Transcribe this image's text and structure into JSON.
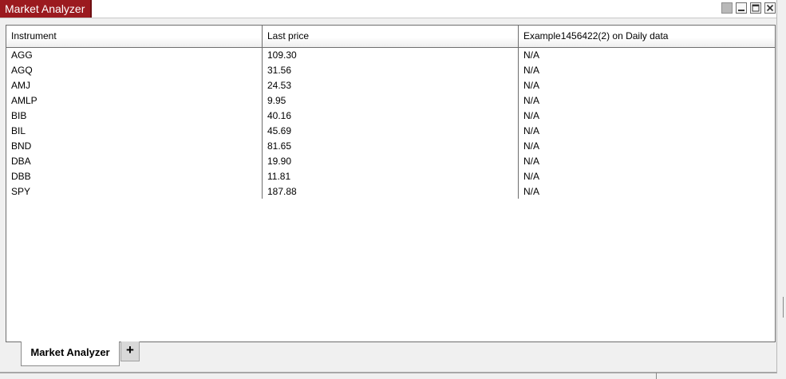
{
  "window": {
    "title": "Market Analyzer",
    "controls": [
      "gray-square",
      "minimize",
      "maximize",
      "close"
    ]
  },
  "grid": {
    "columns": [
      "Instrument",
      "Last price",
      "Example1456422(2) on Daily data"
    ],
    "rows": [
      {
        "instrument": "AGG",
        "last": "109.30",
        "example": "N/A"
      },
      {
        "instrument": "AGQ",
        "last": "31.56",
        "example": "N/A"
      },
      {
        "instrument": "AMJ",
        "last": "24.53",
        "example": "N/A"
      },
      {
        "instrument": "AMLP",
        "last": "9.95",
        "example": "N/A"
      },
      {
        "instrument": "BIB",
        "last": "40.16",
        "example": "N/A"
      },
      {
        "instrument": "BIL",
        "last": "45.69",
        "example": "N/A"
      },
      {
        "instrument": "BND",
        "last": "81.65",
        "example": "N/A"
      },
      {
        "instrument": "DBA",
        "last": "19.90",
        "example": "N/A"
      },
      {
        "instrument": "DBB",
        "last": "11.81",
        "example": "N/A"
      },
      {
        "instrument": "SPY",
        "last": "187.88",
        "example": "N/A"
      }
    ]
  },
  "tabs": {
    "active_label": "Market Analyzer",
    "add_label": "+"
  },
  "colors": {
    "title_accent": "#9b1a1f"
  }
}
